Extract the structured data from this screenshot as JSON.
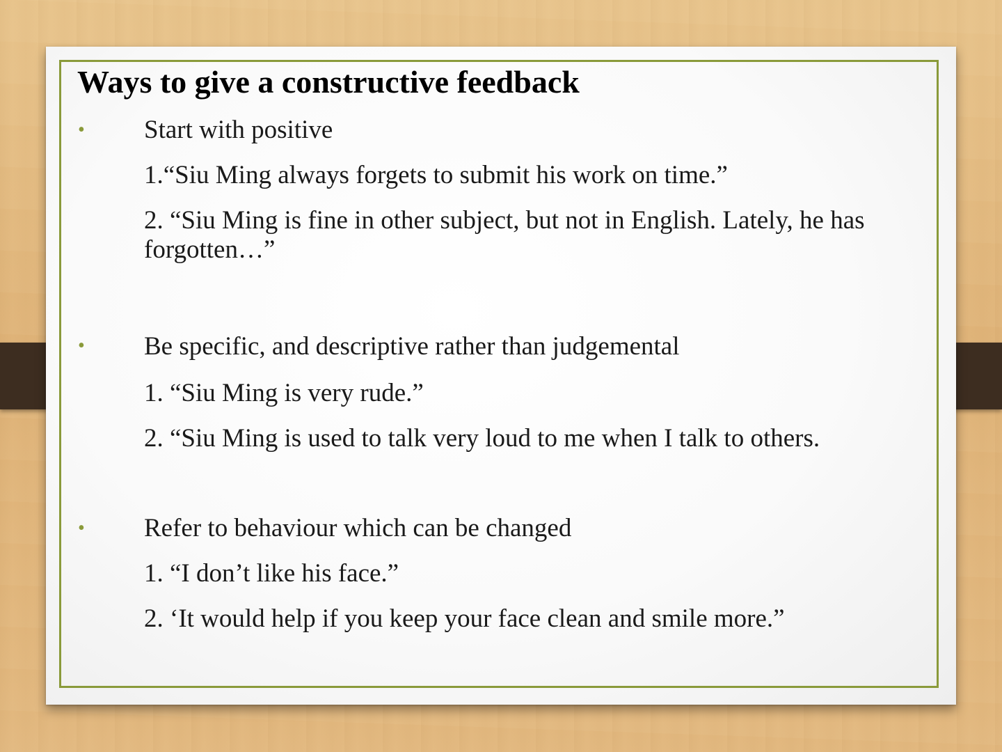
{
  "slide": {
    "title": "Ways to give a constructive feedback",
    "bullet_char": "•",
    "sections": [
      {
        "heading": "Start with positive",
        "examples": [
          "1.“Siu Ming always forgets to submit his work on time.”",
          "2. “Siu Ming is fine in other subject, but not in English. Lately, he has forgotten…”"
        ]
      },
      {
        "heading": "Be specific, and descriptive rather than judgemental",
        "examples": [
          "1. “Siu Ming is very rude.”",
          "2. “Siu Ming is used to talk very loud to me when I talk to others."
        ]
      },
      {
        "heading": "Refer to behaviour which can be changed",
        "examples": [
          "1. “I don’t like his face.”",
          "2. ‘It would help if you keep your face clean and smile more.”"
        ]
      }
    ]
  },
  "colors": {
    "frame_border": "#8a9a3a",
    "bullet": "#8a9a3a",
    "strap": "#3d2d20",
    "background_wood": "#e2b87f"
  }
}
